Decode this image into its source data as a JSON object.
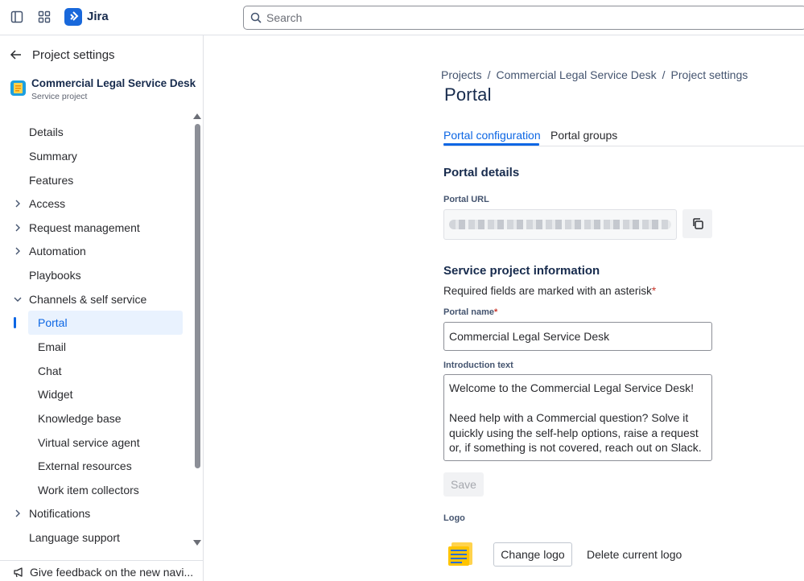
{
  "topbar": {
    "app_name": "Jira",
    "search_placeholder": "Search"
  },
  "sidebar": {
    "back_label": "Project settings",
    "project_name": "Commercial Legal Service Desk",
    "project_type": "Service project",
    "items": [
      {
        "label": "Details"
      },
      {
        "label": "Summary"
      },
      {
        "label": "Features"
      },
      {
        "label": "Access"
      },
      {
        "label": "Request management"
      },
      {
        "label": "Automation"
      },
      {
        "label": "Playbooks"
      },
      {
        "label": "Channels & self service"
      },
      {
        "label": "Portal"
      },
      {
        "label": "Email"
      },
      {
        "label": "Chat"
      },
      {
        "label": "Widget"
      },
      {
        "label": "Knowledge base"
      },
      {
        "label": "Virtual service agent"
      },
      {
        "label": "External resources"
      },
      {
        "label": "Work item collectors"
      },
      {
        "label": "Notifications"
      },
      {
        "label": "Language support"
      }
    ],
    "feedback_label": "Give feedback on the new navi..."
  },
  "breadcrumbs": [
    "Projects",
    "Commercial Legal Service Desk",
    "Project settings"
  ],
  "page_title": "Portal",
  "tabs": [
    {
      "label": "Portal configuration"
    },
    {
      "label": "Portal groups"
    }
  ],
  "portal_details": {
    "heading": "Portal details",
    "url_label": "Portal URL"
  },
  "project_info": {
    "heading": "Service project information",
    "required_note": "Required fields are marked with an asterisk",
    "required_mark": "*",
    "portal_name_label": "Portal name",
    "portal_name_value": "Commercial Legal Service Desk",
    "intro_label": "Introduction text",
    "intro_value": "Welcome to the Commercial Legal Service Desk!\n\nNeed help with a Commercial question? Solve it quickly using the self-help options, raise a request or, if something is not covered, reach out on Slack.",
    "save_label": "Save"
  },
  "logo": {
    "label": "Logo",
    "change_label": "Change logo",
    "delete_label": "Delete current logo"
  }
}
